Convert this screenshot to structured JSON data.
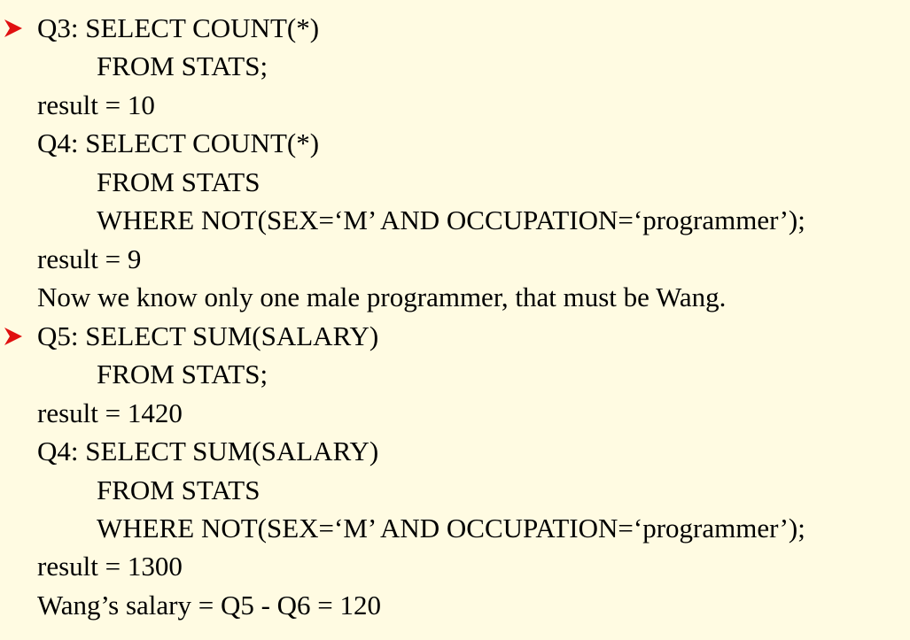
{
  "bullet_color": "#e01010",
  "bullet_icon": "arrowhead-bullet-icon",
  "lines": [
    "Q3: SELECT COUNT(*)",
    "FROM STATS;",
    "result = 10",
    "Q4: SELECT COUNT(*)",
    "FROM STATS",
    "WHERE NOT(SEX=‘M’ AND OCCUPATION=‘programmer’);",
    "result = 9",
    "Now we know only one male programmer, that must be Wang.",
    "Q5: SELECT SUM(SALARY)",
    "FROM STATS;",
    "result = 1420",
    "Q4: SELECT SUM(SALARY)",
    "FROM STATS",
    "WHERE NOT(SEX=‘M’ AND OCCUPATION=‘programmer’);",
    "result = 1300",
    "Wang’s salary = Q5 - Q6 = 120"
  ]
}
